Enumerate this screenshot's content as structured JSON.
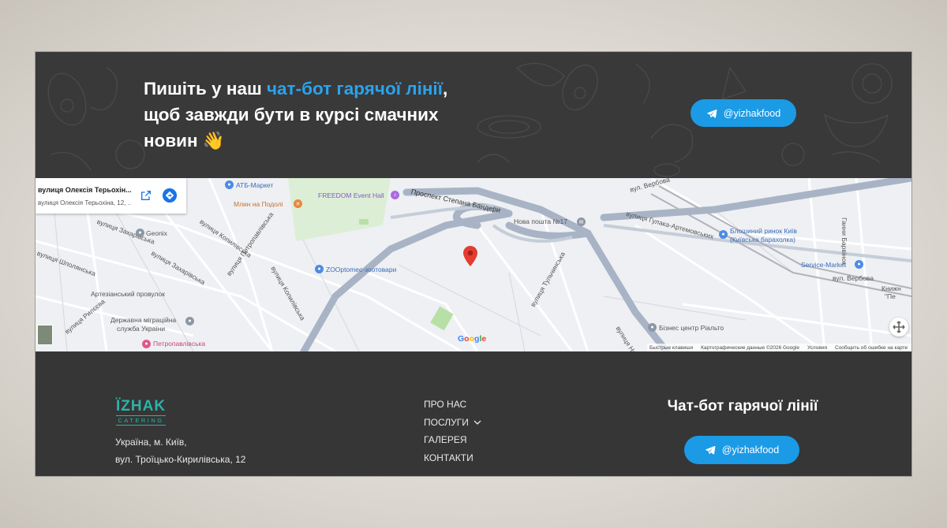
{
  "banner": {
    "title_part1": "Пишіть у наш ",
    "title_highlight": "чат-бот гарячої лінії",
    "title_part2": ", щоб завжди бути в курсі смачних новин ",
    "title_emoji": "👋",
    "button_label": "@yizhakfood"
  },
  "map": {
    "place_name": "вулиця Олексія Терьохін...",
    "place_address": "вулиця Олексія Терьохіна, 12, ...",
    "google_logo": "Google",
    "attribution": [
      "Быстрые клавиши",
      "Картографические данные ©2026 Google",
      "Условия",
      "Сообщить об ошибке на карте"
    ],
    "labels": {
      "atb": "АТБ-Маркет",
      "freedom": "FREEDOM Event Hall",
      "prospekt": "Проспект Степана Бандери",
      "verbova": "вул. Вербова",
      "hanny": "Ганни Барвінок",
      "mlyn": "Млин на Подолі",
      "nova_poshta": "Нова пошта №17",
      "gulaka": "вулиця Гулака-Артемовських",
      "zakharivska1": "вулиця Захарівська",
      "geonix": "Geonix",
      "kopylivska": "вулиця Копилівська",
      "blyshyniy1": "Блошиний ринок Київ",
      "blyshyniy2": "(Київська барахолка)",
      "shpolyanska": "вулиця Шполянська",
      "petropavlivska_st": "вулиця Петропавлівська",
      "zakharivska2": "вулиця Захарівська",
      "zoopt": "ZOOptomec-зоотовари",
      "kopylivska2": "вулиця Копилівська",
      "tulchynska": "вулиця Тульчинська",
      "service": "Service-Market",
      "verbova2": "вул. Вербова",
      "knyzh1": "Книжн",
      "knyzh2": "\"Пе",
      "artezian": "Артезіанський провулок",
      "ryleeva": "вулиця Рилєєва",
      "migration1": "Державна міграційна",
      "migration2": "служба України",
      "vulytsya_nov": "вулиця Нов",
      "bizcenter": "Бізнес центр Ріальто",
      "petropavlivska_metro": "Петропавлівська"
    }
  },
  "footer": {
    "logo_main": "ÏZHAK",
    "logo_sub": "CATERING",
    "address_line1": "Україна, м. Київ,",
    "address_line2": "вул. Троїцько-Кирилівська, 12",
    "nav": [
      "ПРО НАС",
      "ПОСЛУГИ",
      "ГАЛЕРЕЯ",
      "КОНТАКТИ"
    ],
    "hotline_title": "Чат-бот гарячої лінії",
    "button_label": "@yizhakfood"
  },
  "colors": {
    "accent": "#1b9ae6",
    "highlight": "#2aa3ee",
    "logo": "#2bb3a8",
    "background_dark": "#393939"
  },
  "icons": {
    "telegram": "telegram-icon",
    "chevron": "chevron-down-icon",
    "pin": "map-pin-icon"
  }
}
